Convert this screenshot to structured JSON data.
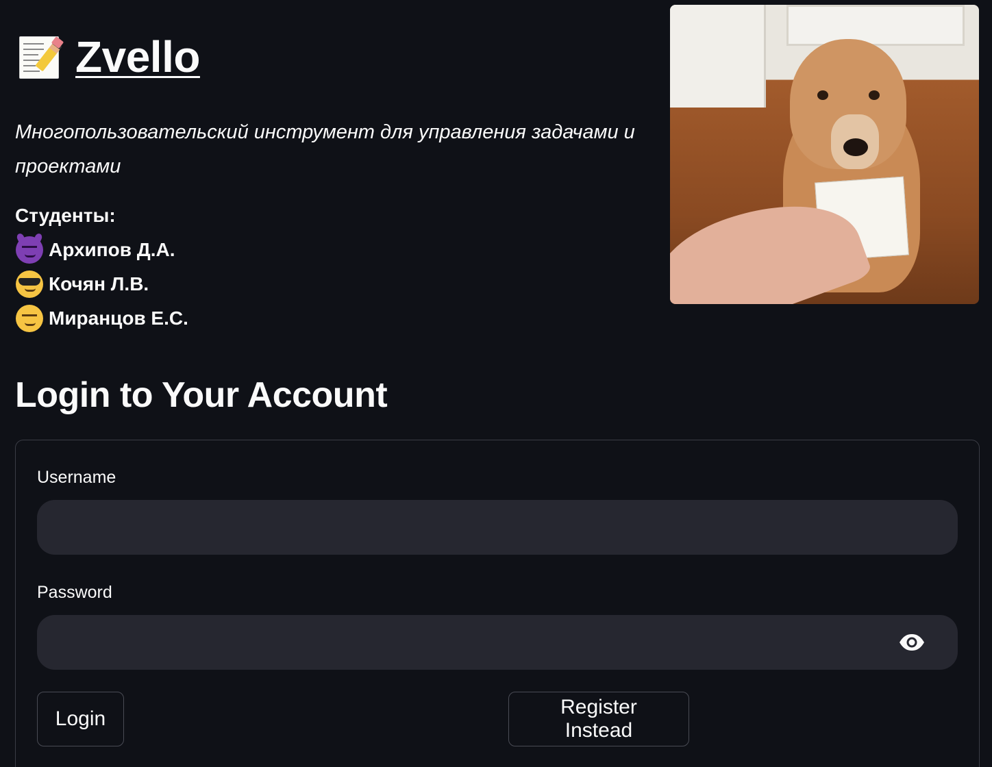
{
  "header": {
    "app_title": "Zvello",
    "title_icon": "memo-icon",
    "subtitle": "Многопользовательский инструмент для управления задачами и проектами",
    "students_label": "Студенты:",
    "students": [
      {
        "emoji": "smiling-devil-emoji",
        "name": "Архипов Д.А."
      },
      {
        "emoji": "sunglasses-emoji",
        "name": "Кочян Л.В."
      },
      {
        "emoji": "smirking-face-emoji",
        "name": "Миранцов Е.С."
      }
    ]
  },
  "login": {
    "heading": "Login to Your Account",
    "username_label": "Username",
    "username_value": "",
    "password_label": "Password",
    "password_value": "",
    "login_button": "Login",
    "register_button": "Register Instead"
  },
  "colors": {
    "background": "#0f1117",
    "input_background": "#262730",
    "text": "#fafafa",
    "border": "#3b3d46"
  }
}
